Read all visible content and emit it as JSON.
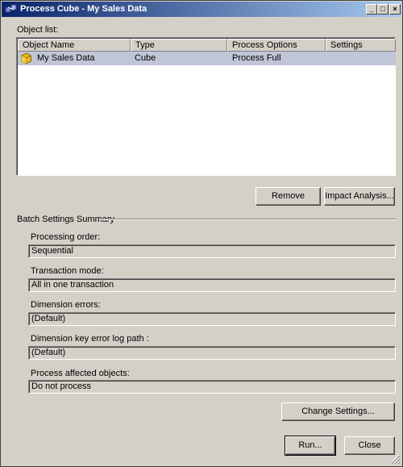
{
  "window": {
    "title": "Process Cube - My Sales Data",
    "controls": {
      "minimize": "_",
      "maximize": "□",
      "close": "×"
    }
  },
  "object_list": {
    "label": "Object list:",
    "columns": [
      "Object Name",
      "Type",
      "Process Options",
      "Settings"
    ],
    "rows": [
      {
        "name": "My Sales Data",
        "type": "Cube",
        "process_options": "Process Full",
        "settings": "",
        "icon": "cube-icon"
      }
    ]
  },
  "buttons": {
    "remove": "Remove",
    "impact_analysis": "Impact Analysis...",
    "change_settings": "Change Settings...",
    "run": "Run...",
    "close": "Close"
  },
  "batch": {
    "heading": "Batch Settings Summary",
    "processing_order": {
      "label": "Processing order:",
      "value": "Sequential"
    },
    "transaction_mode": {
      "label": "Transaction mode:",
      "value": "All in one transaction"
    },
    "dimension_errors": {
      "label": "Dimension errors:",
      "value": "(Default)"
    },
    "dimension_key_error_log_path": {
      "label": "Dimension key error log path :",
      "value": "(Default)"
    },
    "process_affected_objects": {
      "label": "Process affected objects:",
      "value": "Do not process"
    }
  },
  "colors": {
    "titlebar_start": "#0a246a",
    "titlebar_end": "#a6caf0",
    "selected_row": "#c0c6d8",
    "face": "#d4d0c8"
  }
}
